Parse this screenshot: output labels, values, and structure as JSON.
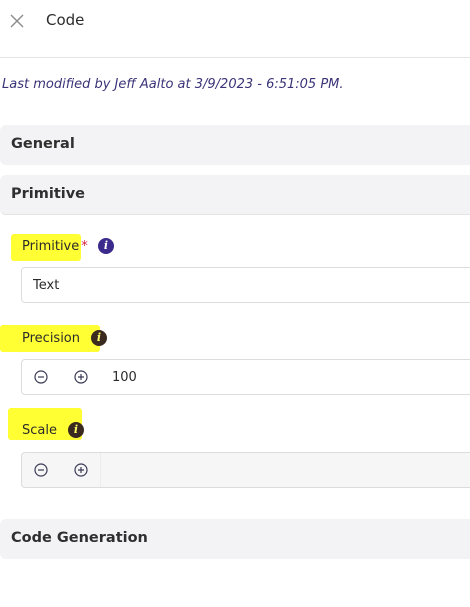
{
  "header": {
    "title": "Code",
    "close_icon": "close-icon"
  },
  "meta": {
    "last_modified": "Last modified by Jeff Aalto at 3/9/2023 - 6:51:05 PM."
  },
  "sections": {
    "general": {
      "title": "General",
      "expanded": false
    },
    "primitive": {
      "title": "Primitive",
      "expanded": true
    },
    "code_generation": {
      "title": "Code Generation",
      "expanded": false
    }
  },
  "fields": {
    "primitive": {
      "label": "Primitive",
      "required_mark": "*",
      "value": "Text",
      "info_icon": "info-icon"
    },
    "precision": {
      "label": "Precision",
      "value": "100",
      "decrement_icon": "minus-circle-icon",
      "increment_icon": "plus-circle-icon",
      "info_icon": "info-icon"
    },
    "scale": {
      "label": "Scale",
      "value": "",
      "decrement_icon": "minus-circle-icon",
      "increment_icon": "plus-circle-icon",
      "info_icon": "info-icon"
    }
  },
  "colors": {
    "highlight": "#ffff33",
    "info_icon_primary": "#3c2a8c",
    "info_icon_highlighted": "#3b2a20",
    "meta_text": "#3a3478",
    "required": "#d9233a"
  }
}
